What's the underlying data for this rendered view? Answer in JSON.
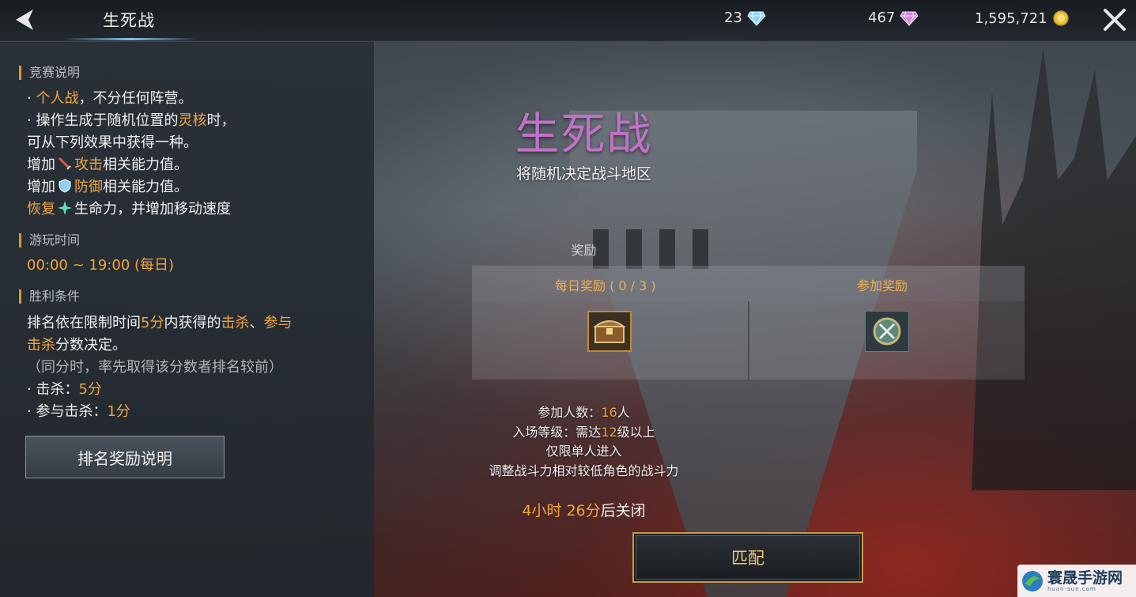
{
  "header": {
    "title": "生死战",
    "currencies": [
      {
        "value": "23",
        "icon": "diamond-icon",
        "color": "#8fd6f0"
      },
      {
        "value": "467",
        "icon": "gem-icon",
        "color": "#d08ad8"
      },
      {
        "value": "1,595,721",
        "icon": "gold-coin-icon",
        "color": "#e8c23a"
      }
    ]
  },
  "rules": {
    "intro_heading": "竞赛说明",
    "intro_l1_pre": "· ",
    "intro_l1_hl": "个人战",
    "intro_l1_post": "，不分任何阵营。",
    "intro_l2_pre": "· 操作生成于随机位置的",
    "intro_l2_hl": "灵核",
    "intro_l2_post": "时，",
    "intro_l3": "可从下列效果中获得一种。",
    "effect1_pre": "增加",
    "effect1_hl": "攻击",
    "effect1_post": "相关能力值。",
    "effect2_pre": "增加",
    "effect2_hl": "防御",
    "effect2_post": "相关能力值。",
    "effect3_hl": "恢复",
    "effect3_post": "生命力，并增加移动速度",
    "time_heading": "游玩时间",
    "time_value": "00:00 ~ 19:00 (每日)",
    "win_heading": "胜利条件",
    "win_l1_a": "排名依在限制时间",
    "win_l1_b": "5分",
    "win_l1_c": "内获得的",
    "win_l1_d": "击杀",
    "win_l1_e": "、",
    "win_l1_f": "参与",
    "win_l2_a": "击杀",
    "win_l2_b": "分数决定。",
    "win_note": "（同分时，率先取得该分数者排名较前）",
    "kill_label": "· 击杀：",
    "kill_value": "5分",
    "assist_label": "· 参与击杀：",
    "assist_value": "1分",
    "rank_button": "排名奖励说明"
  },
  "mode": {
    "title": "生死战",
    "subtitle": "将随机决定战斗地区",
    "reward_label": "奖励",
    "daily_reward": "每日奖励 ( 0 / 3 )",
    "join_reward": "参加奖励",
    "participants_label": "参加人数：",
    "participants_value": "16",
    "participants_unit": "人",
    "level_label": "入场等级：需达",
    "level_value": "12",
    "level_unit": "级以上",
    "solo": "仅限单人进入",
    "power_adjust": "调整战斗力相对较低角色的战斗力",
    "closing_time": "4小时 26分",
    "closing_suffix": "后关闭",
    "match_button": "匹配"
  },
  "watermark": {
    "text": "寰晟手游网",
    "sub": "huan-sun.com"
  }
}
